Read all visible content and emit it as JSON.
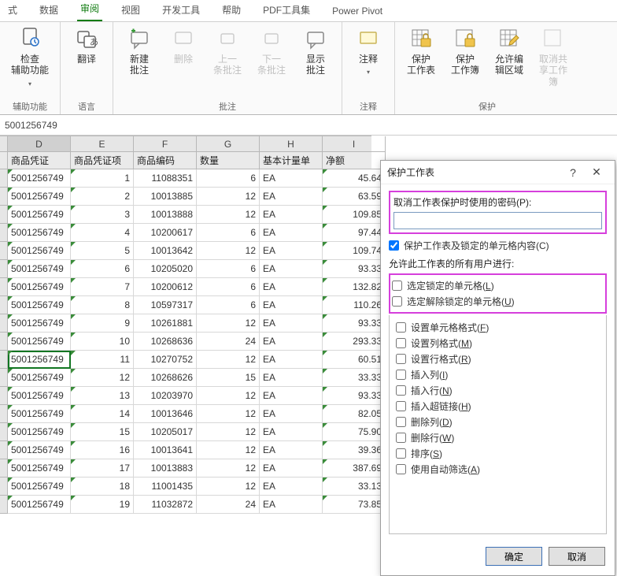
{
  "ribbon": {
    "tabs": [
      "式",
      "数据",
      "审阅",
      "视图",
      "开发工具",
      "帮助",
      "PDF工具集",
      "Power Pivot"
    ],
    "active_index": 2,
    "groups": {
      "accessibility": {
        "btn": "检查\n辅助功能",
        "label": "辅助功能"
      },
      "language": {
        "btn": "翻译",
        "label": "语言"
      },
      "comments": {
        "new": "新建\n批注",
        "del": "删除",
        "prev": "上一\n条批注",
        "next": "下一\n条批注",
        "show": "显示\n批注",
        "label": "批注"
      },
      "notes": {
        "btn": "注释",
        "label": "注释"
      },
      "protect": {
        "p1": "保护\n工作表",
        "p2": "保护\n工作簿",
        "p3": "允许编\n辑区域",
        "p4": "取消共\n享工作簿",
        "label": "保护"
      }
    }
  },
  "formula_bar": {
    "value": "5001256749"
  },
  "sheet": {
    "columns": [
      "D",
      "E",
      "F",
      "G",
      "H",
      "I"
    ],
    "headers": [
      "商品凭证",
      "商品凭证项",
      "商品编码",
      "数量",
      "基本计量单",
      "净额"
    ],
    "selected": {
      "row_index": 10,
      "col_index": 0
    },
    "rows": [
      {
        "d": "5001256749",
        "e": "1",
        "f": "11088351",
        "g": "6",
        "h": "EA",
        "i": "45.64"
      },
      {
        "d": "5001256749",
        "e": "2",
        "f": "10013885",
        "g": "12",
        "h": "EA",
        "i": "63.59"
      },
      {
        "d": "5001256749",
        "e": "3",
        "f": "10013888",
        "g": "12",
        "h": "EA",
        "i": "109.85"
      },
      {
        "d": "5001256749",
        "e": "4",
        "f": "10200617",
        "g": "6",
        "h": "EA",
        "i": "97.44"
      },
      {
        "d": "5001256749",
        "e": "5",
        "f": "10013642",
        "g": "12",
        "h": "EA",
        "i": "109.74"
      },
      {
        "d": "5001256749",
        "e": "6",
        "f": "10205020",
        "g": "6",
        "h": "EA",
        "i": "93.33"
      },
      {
        "d": "5001256749",
        "e": "7",
        "f": "10200612",
        "g": "6",
        "h": "EA",
        "i": "132.82"
      },
      {
        "d": "5001256749",
        "e": "8",
        "f": "10597317",
        "g": "6",
        "h": "EA",
        "i": "110.26"
      },
      {
        "d": "5001256749",
        "e": "9",
        "f": "10261881",
        "g": "12",
        "h": "EA",
        "i": "93.33"
      },
      {
        "d": "5001256749",
        "e": "10",
        "f": "10268636",
        "g": "24",
        "h": "EA",
        "i": "293.33"
      },
      {
        "d": "5001256749",
        "e": "11",
        "f": "10270752",
        "g": "12",
        "h": "EA",
        "i": "60.51"
      },
      {
        "d": "5001256749",
        "e": "12",
        "f": "10268626",
        "g": "15",
        "h": "EA",
        "i": "33.33"
      },
      {
        "d": "5001256749",
        "e": "13",
        "f": "10203970",
        "g": "12",
        "h": "EA",
        "i": "93.33"
      },
      {
        "d": "5001256749",
        "e": "14",
        "f": "10013646",
        "g": "12",
        "h": "EA",
        "i": "82.05"
      },
      {
        "d": "5001256749",
        "e": "15",
        "f": "10205017",
        "g": "12",
        "h": "EA",
        "i": "75.90"
      },
      {
        "d": "5001256749",
        "e": "16",
        "f": "10013641",
        "g": "12",
        "h": "EA",
        "i": "39.36"
      },
      {
        "d": "5001256749",
        "e": "17",
        "f": "10013883",
        "g": "12",
        "h": "EA",
        "i": "387.69"
      },
      {
        "d": "5001256749",
        "e": "18",
        "f": "11001435",
        "g": "12",
        "h": "EA",
        "i": "33.13"
      },
      {
        "d": "5001256749",
        "e": "19",
        "f": "11032872",
        "g": "24",
        "h": "EA",
        "i": "73.85"
      }
    ]
  },
  "dialog": {
    "title": "保护工作表",
    "pw_label": "取消工作表保护时使用的密码(P):",
    "pw_value": "",
    "protect_chk": {
      "checked": true,
      "label": "保护工作表及锁定的单元格内容(C)"
    },
    "list_label": "允许此工作表的所有用户进行:",
    "highlight_perms": [
      {
        "label": "选定锁定的单元格(L)",
        "u": "L",
        "checked": false
      },
      {
        "label": "选定解除锁定的单元格(U)",
        "u": "U",
        "checked": false
      }
    ],
    "perms": [
      {
        "label": "设置单元格格式(F)",
        "u": "F",
        "checked": false
      },
      {
        "label": "设置列格式(M)",
        "u": "M",
        "checked": false
      },
      {
        "label": "设置行格式(R)",
        "u": "R",
        "checked": false
      },
      {
        "label": "插入列(I)",
        "u": "I",
        "checked": false
      },
      {
        "label": "插入行(N)",
        "u": "N",
        "checked": false
      },
      {
        "label": "插入超链接(H)",
        "u": "H",
        "checked": false
      },
      {
        "label": "删除列(D)",
        "u": "D",
        "checked": false
      },
      {
        "label": "删除行(W)",
        "u": "W",
        "checked": false
      },
      {
        "label": "排序(S)",
        "u": "S",
        "checked": false
      },
      {
        "label": "使用自动筛选(A)",
        "u": "A",
        "checked": false
      }
    ],
    "ok": "确定",
    "cancel": "取消"
  }
}
